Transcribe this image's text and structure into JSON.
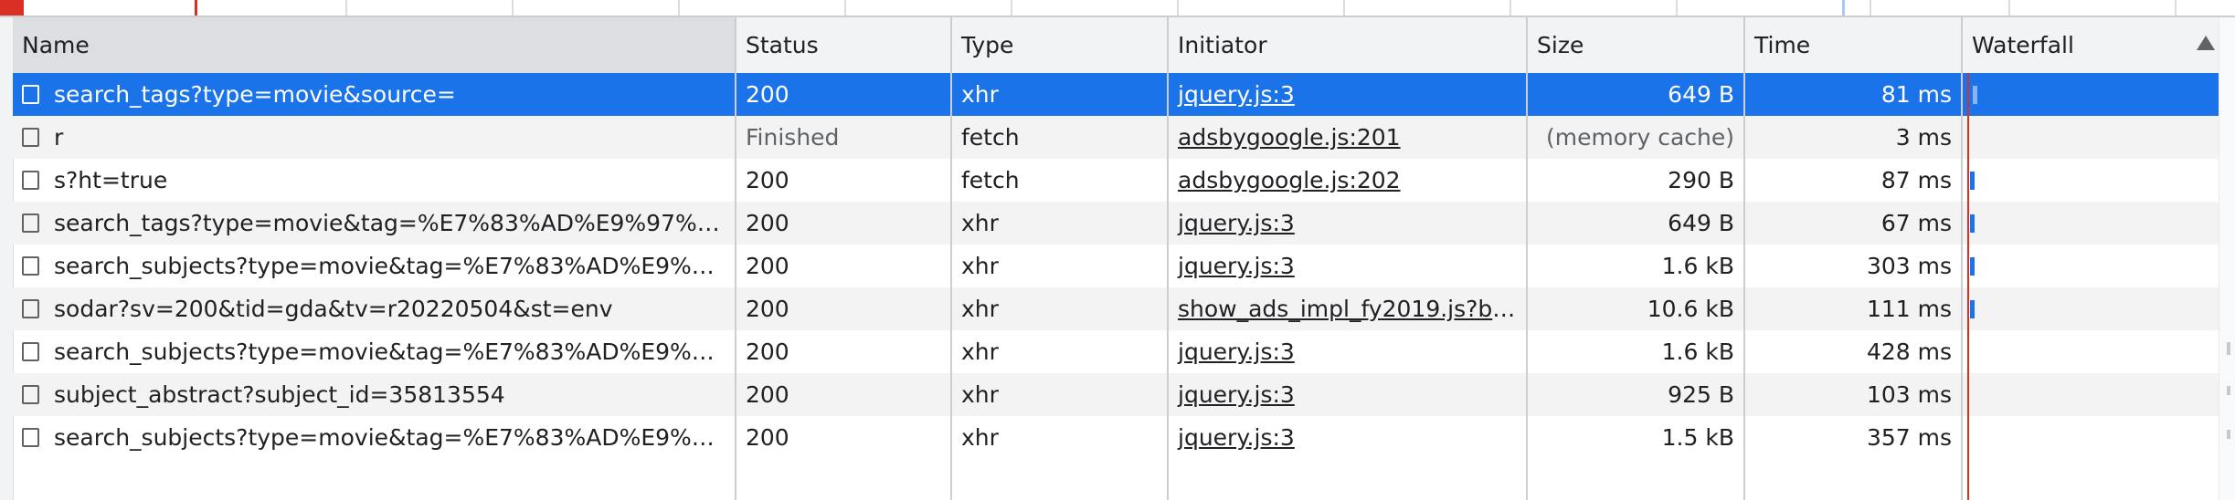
{
  "columns": {
    "name": "Name",
    "status": "Status",
    "type": "Type",
    "initiator": "Initiator",
    "size": "Size",
    "time": "Time",
    "waterfall": "Waterfall"
  },
  "rows": [
    {
      "name": "search_tags?type=movie&source=",
      "status": "200",
      "type": "xhr",
      "initiator": "jquery.js:3",
      "size": "649 B",
      "time": "81 ms",
      "selected": true
    },
    {
      "name": "r",
      "status": "Finished",
      "type": "fetch",
      "initiator": "adsbygoogle.js:201",
      "size": "(memory cache)",
      "time": "3 ms"
    },
    {
      "name": "s?ht=true",
      "status": "200",
      "type": "fetch",
      "initiator": "adsbygoogle.js:202",
      "size": "290 B",
      "time": "87 ms"
    },
    {
      "name": "search_tags?type=movie&tag=%E7%83%AD%E9%97%A8...",
      "status": "200",
      "type": "xhr",
      "initiator": "jquery.js:3",
      "size": "649 B",
      "time": "67 ms"
    },
    {
      "name": "search_subjects?type=movie&tag=%E7%83%AD%E9%97%...",
      "status": "200",
      "type": "xhr",
      "initiator": "jquery.js:3",
      "size": "1.6 kB",
      "time": "303 ms"
    },
    {
      "name": "sodar?sv=200&tid=gda&tv=r20220504&st=env",
      "status": "200",
      "type": "xhr",
      "initiator": "show_ads_impl_fy2019.js?bus...",
      "size": "10.6 kB",
      "time": "111 ms"
    },
    {
      "name": "search_subjects?type=movie&tag=%E7%83%AD%E9%97%...",
      "status": "200",
      "type": "xhr",
      "initiator": "jquery.js:3",
      "size": "1.6 kB",
      "time": "428 ms"
    },
    {
      "name": "subject_abstract?subject_id=35813554",
      "status": "200",
      "type": "xhr",
      "initiator": "jquery.js:3",
      "size": "925 B",
      "time": "103 ms"
    },
    {
      "name": "search_subjects?type=movie&tag=%E7%83%AD%E9%97%...",
      "status": "200",
      "type": "xhr",
      "initiator": "jquery.js:3",
      "size": "1.5 kB",
      "time": "357 ms"
    }
  ],
  "sort": {
    "column": "waterfall",
    "direction": "ascending",
    "icon": "sort-ascending-icon"
  },
  "colors": {
    "selected_row": "#1a73e8",
    "waterfall_bar": "#1a73e8",
    "timeline_marker": "#d93025"
  }
}
